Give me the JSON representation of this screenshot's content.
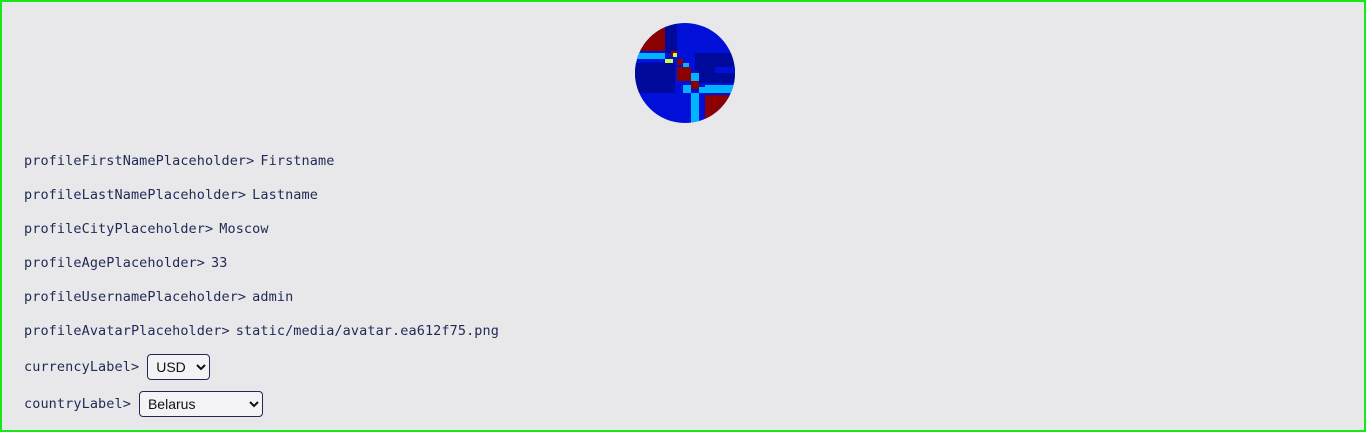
{
  "avatar": {
    "alt": "avatar",
    "colors": {
      "dark_red": "#8b0000",
      "blue": "#0010d8",
      "navy": "#000a9a",
      "cyan": "#00b4ff",
      "yellow": "#c8ff40"
    }
  },
  "profile": [
    {
      "key": "profileFirstNamePlaceholder",
      "value": "Firstname"
    },
    {
      "key": "profileLastNamePlaceholder",
      "value": "Lastname"
    },
    {
      "key": "profileCityPlaceholder",
      "value": "Moscow"
    },
    {
      "key": "profileAgePlaceholder",
      "value": "33"
    },
    {
      "key": "profileUsernamePlaceholder",
      "value": "admin"
    },
    {
      "key": "profileAvatarPlaceholder",
      "value": "static/media/avatar.ea612f75.png"
    }
  ],
  "separator": ">",
  "currency": {
    "label": "currencyLabel",
    "selected": "USD"
  },
  "country": {
    "label": "countryLabel",
    "selected": "Belarus"
  }
}
